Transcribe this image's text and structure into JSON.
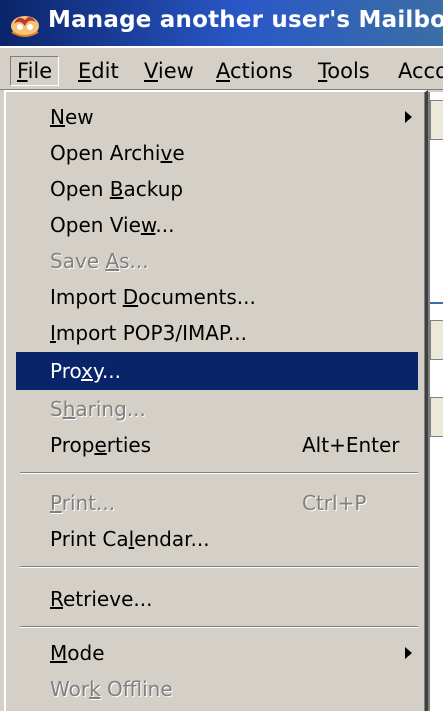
{
  "window": {
    "title": "Manage another user's Mailbox",
    "app_icon": "app-logo-icon"
  },
  "menubar": {
    "items": [
      {
        "label": "File",
        "accel": "F",
        "rest": "ile",
        "active": true
      },
      {
        "label": "Edit",
        "accel": "E",
        "rest": "dit"
      },
      {
        "label": "View",
        "accel": "V",
        "rest": "iew"
      },
      {
        "label": "Actions",
        "accel": "A",
        "rest": "ctions"
      },
      {
        "label": "Tools",
        "accel": "T",
        "rest": "ools"
      },
      {
        "label": "Acco",
        "accel": "",
        "rest": "Acco"
      }
    ]
  },
  "file_menu": {
    "new": {
      "pre": "",
      "accel": "N",
      "post": "ew",
      "submenu": true
    },
    "open_archive": {
      "pre": "Open Archi",
      "accel": "v",
      "post": "e"
    },
    "open_backup": {
      "pre": "Open ",
      "accel": "B",
      "post": "ackup"
    },
    "open_view": {
      "pre": "Open Vie",
      "accel": "w",
      "post": "..."
    },
    "save_as": {
      "pre": "Save ",
      "accel": "A",
      "post": "s...",
      "disabled": true
    },
    "import_documents": {
      "pre": "Import ",
      "accel": "D",
      "post": "ocuments..."
    },
    "import_pop3": {
      "pre": "",
      "accel": "I",
      "post": "mport POP3/IMAP..."
    },
    "proxy": {
      "pre": "Pro",
      "accel": "x",
      "post": "y...",
      "highlighted": true
    },
    "sharing": {
      "pre": "S",
      "accel": "h",
      "post": "aring...",
      "disabled": true
    },
    "properties": {
      "pre": "Prop",
      "accel": "e",
      "post": "rties",
      "shortcut": "Alt+Enter"
    },
    "print": {
      "pre": "",
      "accel": "P",
      "post": "rint...",
      "shortcut": "Ctrl+P",
      "disabled": true
    },
    "print_calendar": {
      "pre": "Print Ca",
      "accel": "l",
      "post": "endar..."
    },
    "retrieve": {
      "pre": "",
      "accel": "R",
      "post": "etrieve..."
    },
    "mode": {
      "pre": "",
      "accel": "M",
      "post": "ode",
      "submenu": true
    },
    "work_offline": {
      "pre": "Wor",
      "accel": "k",
      "post": " Offline",
      "disabled": true
    }
  },
  "colors": {
    "highlight": "#0a246a",
    "menu_bg": "#d4d0c8",
    "disabled_text": "#808080"
  }
}
